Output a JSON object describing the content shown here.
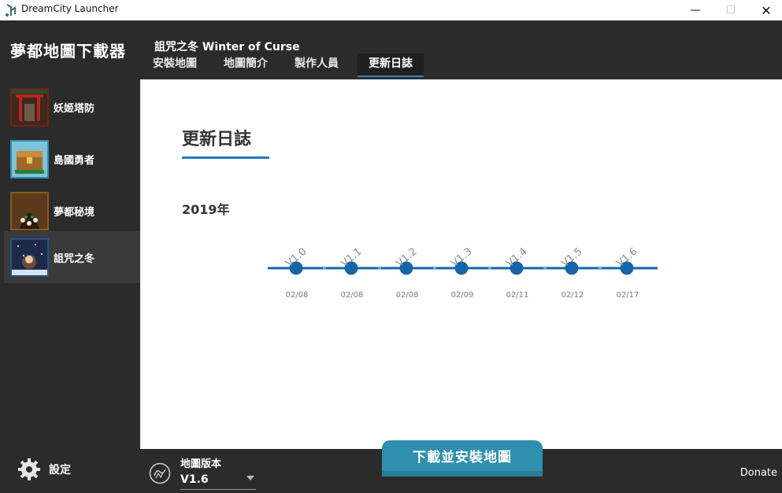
{
  "window": {
    "title": "DreamCity Launcher",
    "minimize": "—",
    "maximize": "☐",
    "close": "✕"
  },
  "sidebar": {
    "brand": "夢都地圖下載器",
    "maps": [
      {
        "label": "妖姬塔防",
        "color": "#7a1c1c"
      },
      {
        "label": "島國勇者",
        "color": "#2f8fae"
      },
      {
        "label": "夢都秘境",
        "color": "#8a5a1e"
      },
      {
        "label": "詛咒之冬",
        "color": "#2a4f8a"
      }
    ],
    "settings_label": "設定"
  },
  "header": {
    "map_title": "詛咒之冬 Winter of Curse",
    "tabs": [
      "安裝地圖",
      "地圖簡介",
      "製作人員",
      "更新日誌"
    ],
    "active_tab": "更新日誌"
  },
  "main": {
    "section_title": "更新日誌",
    "year": "2019年",
    "timeline": [
      {
        "version": "V1.0",
        "date": "02/08"
      },
      {
        "version": "V1.1",
        "date": "02/08"
      },
      {
        "version": "V1.2",
        "date": "02/08"
      },
      {
        "version": "V1.3",
        "date": "02/09"
      },
      {
        "version": "V1.4",
        "date": "02/11"
      },
      {
        "version": "V1.5",
        "date": "02/12"
      },
      {
        "version": "V1.6",
        "date": "02/17"
      }
    ],
    "accent_color": "#1565a8"
  },
  "footer": {
    "version_label": "地圖版本",
    "version_value": "V1.6",
    "install_button": "下載並安裝地圖",
    "donate": "Donate"
  },
  "icons": {
    "app": "app-icon",
    "settings": "gear-icon",
    "version": "map-version-icon",
    "dropdown": "chevron-down-icon"
  }
}
